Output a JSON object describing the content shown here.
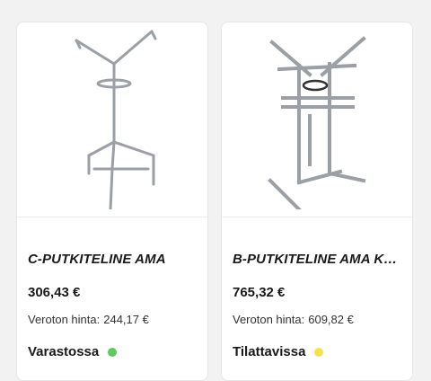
{
  "products": [
    {
      "name": "C-PUTKITELINE AMA",
      "price": "306,43 €",
      "vat_label": "Veroton hinta:",
      "vat_price": "244,17 €",
      "stock_text": "Varastossa",
      "stock_color": "#5ec95e"
    },
    {
      "name": "B-PUTKITELINE AMA KU...",
      "price": "765,32 €",
      "vat_label": "Veroton hinta:",
      "vat_price": "609,82 €",
      "stock_text": "Tilattavissa",
      "stock_color": "#f5e050"
    }
  ],
  "icons": [
    "status-dot-icon"
  ]
}
